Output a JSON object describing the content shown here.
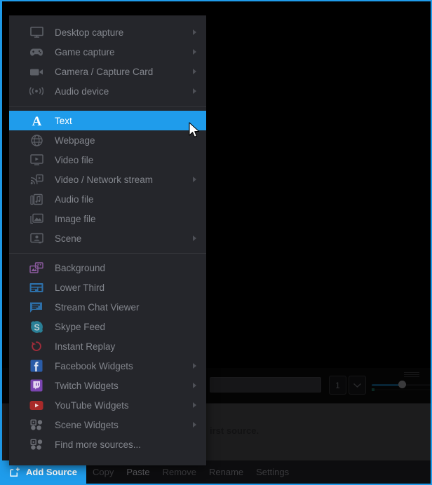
{
  "window": {
    "border_color": "#1f9ceb",
    "background": "#000000"
  },
  "source_menu": {
    "background": "#25262b",
    "highlight_color": "#1f9ceb",
    "label_color": "#83868d",
    "groups": [
      {
        "name": "capture-devices",
        "items": [
          {
            "label": "Desktop capture",
            "icon": "monitor-icon",
            "has_submenu": true,
            "selected": false
          },
          {
            "label": "Game capture",
            "icon": "gamepad-icon",
            "has_submenu": true,
            "selected": false
          },
          {
            "label": "Camera / Capture Card",
            "icon": "camcorder-icon",
            "has_submenu": true,
            "selected": false
          },
          {
            "label": "Audio device",
            "icon": "audio-wave-icon",
            "has_submenu": true,
            "selected": false
          }
        ]
      },
      {
        "name": "media-sources",
        "items": [
          {
            "label": "Text",
            "icon": "text-a-icon",
            "has_submenu": false,
            "selected": true
          },
          {
            "label": "Webpage",
            "icon": "globe-icon",
            "has_submenu": false,
            "selected": false
          },
          {
            "label": "Video file",
            "icon": "video-file-icon",
            "has_submenu": false,
            "selected": false
          },
          {
            "label": "Video / Network stream",
            "icon": "network-stream-icon",
            "has_submenu": true,
            "selected": false
          },
          {
            "label": "Audio file",
            "icon": "audio-file-icon",
            "has_submenu": false,
            "selected": false
          },
          {
            "label": "Image file",
            "icon": "image-file-icon",
            "has_submenu": false,
            "selected": false
          },
          {
            "label": "Scene",
            "icon": "scene-icon",
            "has_submenu": true,
            "selected": false
          }
        ]
      },
      {
        "name": "widgets",
        "items": [
          {
            "label": "Background",
            "icon": "background-icon",
            "has_submenu": false,
            "selected": false,
            "color": "#8b5a9e"
          },
          {
            "label": "Lower Third",
            "icon": "lower-third-icon",
            "has_submenu": false,
            "selected": false,
            "color": "#2d6fa8"
          },
          {
            "label": "Stream Chat Viewer",
            "icon": "chat-bubble-icon",
            "has_submenu": false,
            "selected": false,
            "color": "#2d6fa8"
          },
          {
            "label": "Skype Feed",
            "icon": "skype-icon",
            "has_submenu": false,
            "selected": false,
            "color": "#2a7f96"
          },
          {
            "label": "Instant Replay",
            "icon": "replay-icon",
            "has_submenu": false,
            "selected": false,
            "color": "#a02c3a"
          },
          {
            "label": "Facebook Widgets",
            "icon": "facebook-icon",
            "has_submenu": true,
            "selected": false,
            "color": "#2a5ca8"
          },
          {
            "label": "Twitch Widgets",
            "icon": "twitch-icon",
            "has_submenu": true,
            "selected": false,
            "color": "#7a45b0"
          },
          {
            "label": "YouTube Widgets",
            "icon": "youtube-icon",
            "has_submenu": true,
            "selected": false,
            "color": "#a82a2a"
          },
          {
            "label": "Scene Widgets",
            "icon": "scene-widgets-icon",
            "has_submenu": true,
            "selected": false,
            "color": "#6b6d74"
          },
          {
            "label": "Find more sources...",
            "icon": "find-sources-icon",
            "has_submenu": false,
            "selected": false,
            "color": "#6b6d74"
          }
        ]
      }
    ]
  },
  "toolbar": {
    "add_source_label": "Add Source",
    "add_source_color": "#1f9ceb",
    "items": [
      {
        "label": "Copy",
        "enabled": false
      },
      {
        "label": "Paste",
        "enabled": true
      },
      {
        "label": "Remove",
        "enabled": false
      },
      {
        "label": "Rename",
        "enabled": false
      },
      {
        "label": "Settings",
        "enabled": false
      }
    ]
  },
  "background_app": {
    "hint_text": "irst source.",
    "stepper_value": "1",
    "field_value": "",
    "slider_value": 48
  }
}
